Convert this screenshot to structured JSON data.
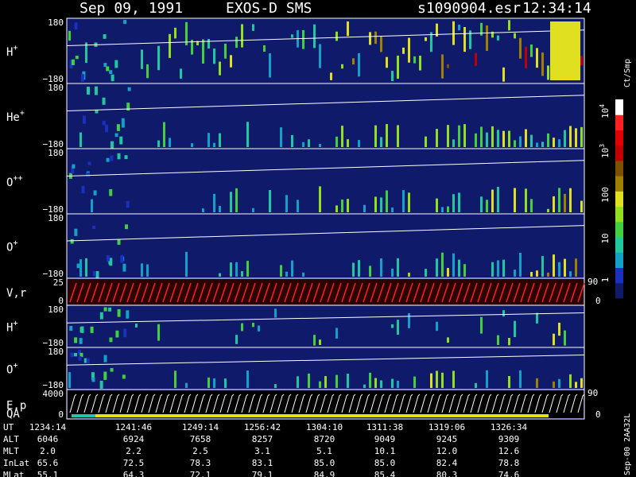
{
  "header": {
    "date": "Sep 09, 1991",
    "instrument": "EXOS-D SMS",
    "file": "s1090904.esr",
    "time": "12:34:14"
  },
  "colors": {
    "background": "#000000",
    "panel": "#0f1a6a",
    "colorbar": [
      "#0f1a6a",
      "#1a30c0",
      "#15a0c8",
      "#20c8a0",
      "#40d040",
      "#90e020",
      "#e0e020",
      "#a08000",
      "#805000",
      "#c00000",
      "#e00000",
      "#ff2020",
      "#ffffff"
    ]
  },
  "chart_data": {
    "type": "heatmap",
    "panels": [
      {
        "id": "p1",
        "label": "H",
        "sup": "+",
        "ymax": "180",
        "ymin": "−180"
      },
      {
        "id": "p2",
        "label": "He",
        "sup": "+",
        "ymax": "180",
        "ymin": "−180"
      },
      {
        "id": "p3",
        "label": "O",
        "sup": "++",
        "ymax": "180",
        "ymin": "−180"
      },
      {
        "id": "p4",
        "label": "O",
        "sup": "+",
        "ymax": "180",
        "ymin": "−180"
      },
      {
        "id": "p5",
        "label": "V,r",
        "sup": "",
        "ymax": "25",
        "ymin": "0",
        "right_top": "90",
        "right_bottom": "0"
      },
      {
        "id": "p6",
        "label": "H",
        "sup": "+",
        "ymax": "180",
        "ymin": "−180"
      },
      {
        "id": "p7",
        "label": "O",
        "sup": "+",
        "ymax": "180",
        "ymin": "−180"
      },
      {
        "id": "p8",
        "label": "E,p",
        "label2": "QA",
        "ymax": "4000",
        "ymin": "0",
        "right_top": "90",
        "right_bottom": "0"
      }
    ],
    "colorbar": {
      "label": "Ct/Smp",
      "ticks": [
        {
          "base": "10",
          "exp": "4"
        },
        {
          "base": "10",
          "exp": "3"
        },
        {
          "base": "100",
          "exp": ""
        },
        {
          "base": "10",
          "exp": ""
        },
        {
          "base": "1",
          "exp": ""
        }
      ]
    },
    "table": {
      "rows": [
        {
          "name": "UT",
          "values": [
            "1234:14",
            "1241:46",
            "1249:14",
            "1256:42",
            "1304:10",
            "1311:38",
            "1319:06",
            "1326:34"
          ]
        },
        {
          "name": "ALT",
          "values": [
            "6046",
            "6924",
            "7658",
            "8257",
            "8720",
            "9049",
            "9245",
            "9309"
          ]
        },
        {
          "name": "MLT",
          "values": [
            "2.0",
            "2.2",
            "2.5",
            "3.1",
            "5.1",
            "10.1",
            "12.0",
            "12.6"
          ]
        },
        {
          "name": "InLat",
          "values": [
            "65.6",
            "72.5",
            "78.3",
            "83.1",
            "85.0",
            "85.0",
            "82.4",
            "78.8"
          ]
        },
        {
          "name": "MLat",
          "values": [
            "55.1",
            "64.3",
            "72.1",
            "79.1",
            "84.9",
            "85.4",
            "80.3",
            "74.6"
          ]
        }
      ]
    },
    "footer_id": "Sep-00  2AA32L"
  }
}
